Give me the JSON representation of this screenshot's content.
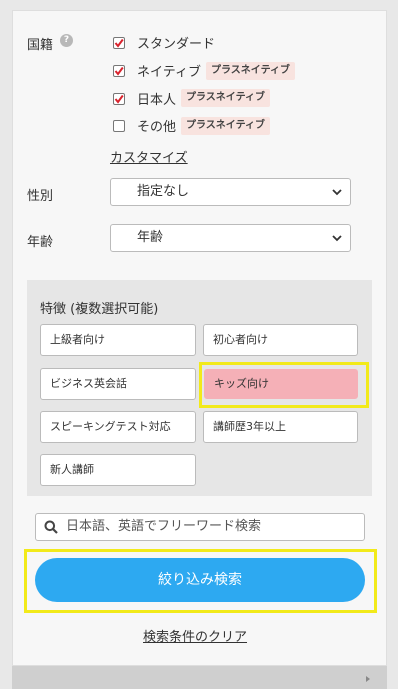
{
  "nationality": {
    "label": "国籍",
    "help_icon": "?",
    "options": [
      {
        "label": "スタンダード",
        "checked": true,
        "tag": ""
      },
      {
        "label": "ネイティブ",
        "checked": true,
        "tag": "プラスネイティブ"
      },
      {
        "label": "日本人",
        "checked": true,
        "tag": "プラスネイティブ"
      },
      {
        "label": "その他",
        "checked": false,
        "tag": "プラスネイティブ"
      }
    ],
    "customize_link": "カスタマイズ"
  },
  "gender": {
    "label": "性別",
    "selected": "指定なし"
  },
  "age": {
    "label": "年齢",
    "selected": "年齢"
  },
  "features": {
    "title": "特徴 (複数選択可能)",
    "chips": [
      {
        "label": "上級者向け",
        "active": false
      },
      {
        "label": "初心者向け",
        "active": false
      },
      {
        "label": "ビジネス英会話",
        "active": false
      },
      {
        "label": "キッズ向け",
        "active": true
      },
      {
        "label": "スピーキングテスト対応",
        "active": false
      },
      {
        "label": "講師歴3年以上",
        "active": false
      },
      {
        "label": "新人講師",
        "active": false
      }
    ]
  },
  "search": {
    "placeholder": "日本語、英語でフリーワード検索",
    "icon": "search-icon"
  },
  "submit_button": "絞り込み検索",
  "clear_link": "検索条件のクリア",
  "colors": {
    "check": "#d9232d",
    "tag_bg": "#f8e3df",
    "chip_active": "#f5b0b7",
    "button": "#2da9f1",
    "highlight": "#f2ea1a"
  }
}
